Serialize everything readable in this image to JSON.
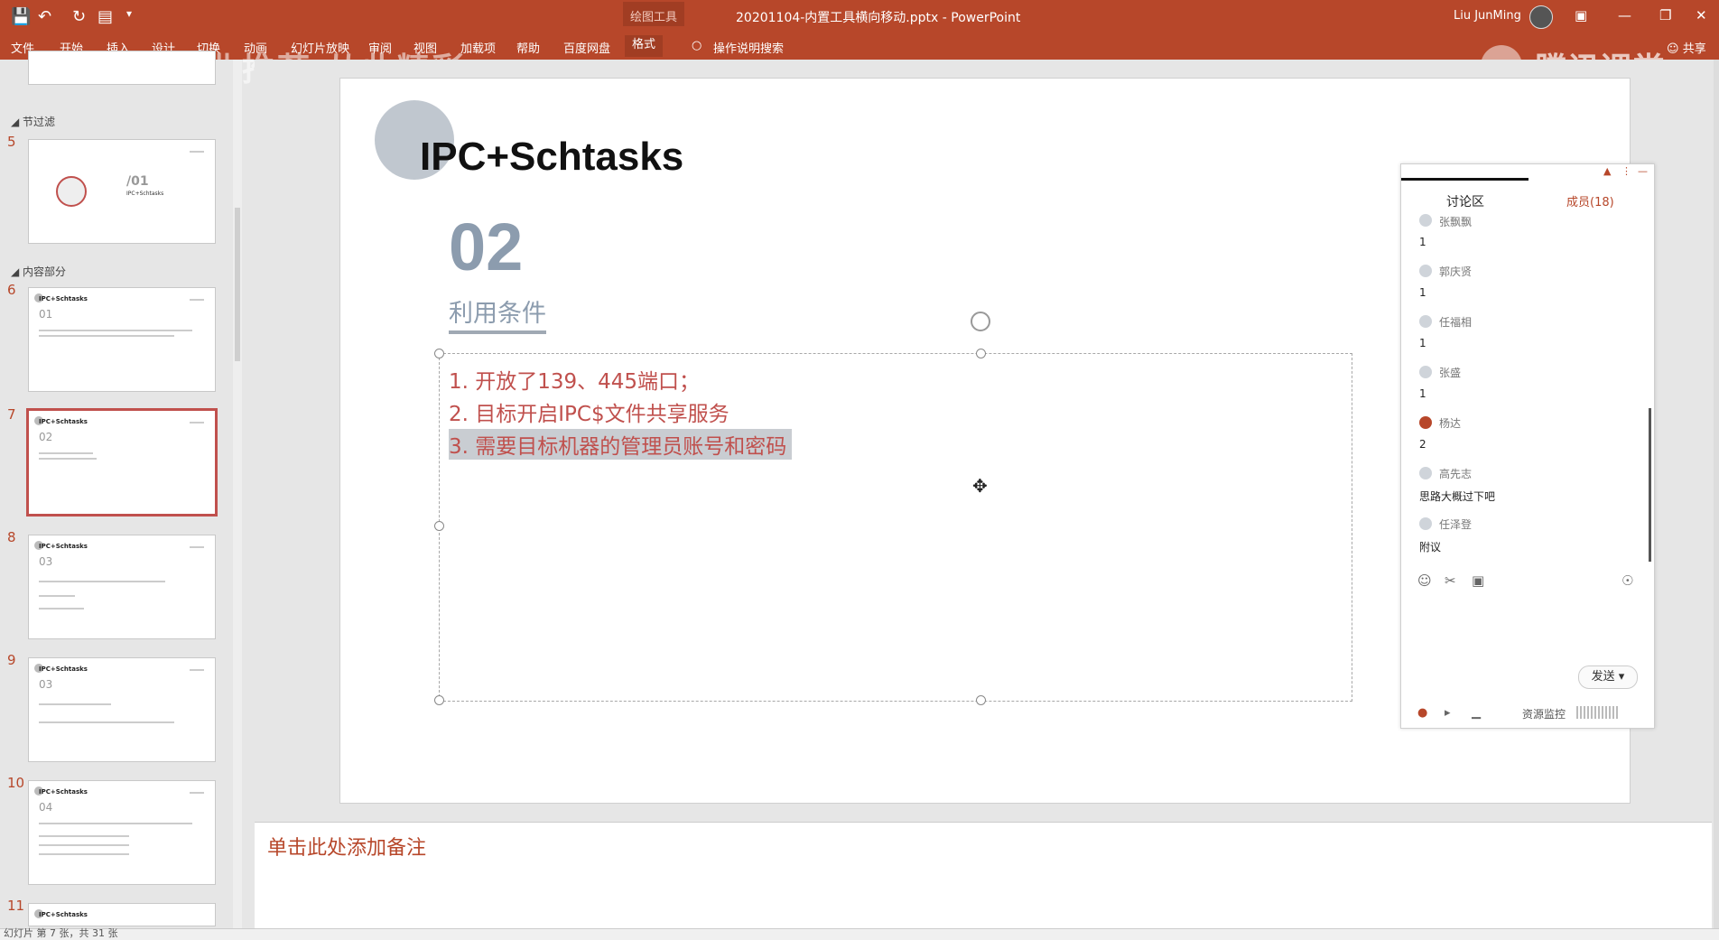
{
  "titlebar": {
    "document_title": "20201104-内置工具横向移动.pptx  -  PowerPoint",
    "context_tool_label": "绘图工具",
    "user_name": "Liu JunMing",
    "share_label": "共享",
    "menu": [
      "文件",
      "开始",
      "插入",
      "设计",
      "切换",
      "动画",
      "幻灯片放映",
      "审阅",
      "视图",
      "加载项",
      "帮助",
      "百度网盘",
      "格式"
    ],
    "tell_me": "操作说明搜索"
  },
  "watermarks": {
    "left": "网络安全就业推荐 从此精彩",
    "right": "腾讯课堂"
  },
  "slide_panel": {
    "sections": [
      "节过滤",
      "内容部分"
    ],
    "slides": [
      {
        "number": "5",
        "title": "/01",
        "subtitle": "IPC+Schtasks"
      },
      {
        "number": "6",
        "title": "IPC+Schtasks",
        "num": "01"
      },
      {
        "number": "7",
        "title": "IPC+Schtasks",
        "num": "02"
      },
      {
        "number": "8",
        "title": "IPC+Schtasks",
        "num": "03"
      },
      {
        "number": "9",
        "title": "IPC+Schtasks",
        "num": "03"
      },
      {
        "number": "10",
        "title": "IPC+Schtasks",
        "num": "04"
      },
      {
        "number": "11",
        "title": "IPC+Schtasks",
        "num": ""
      }
    ]
  },
  "slide": {
    "title": "IPC+Schtasks",
    "section_number": "02",
    "subheading": "利用条件",
    "bullets": [
      "1. 开放了139、445端口；",
      "2. 目标开启IPC$文件共享服务",
      "3. 需要目标机器的管理员账号和密码"
    ]
  },
  "notes": {
    "placeholder": "单击此处添加备注"
  },
  "statusbar": {
    "text": "幻灯片 第 7 张，共 31 张"
  },
  "chat": {
    "tab_discussion": "讨论区",
    "tab_members": "成员(18)",
    "messages": [
      {
        "name": "张飘飘",
        "text": "1"
      },
      {
        "name": "郭庆贤",
        "text": "1"
      },
      {
        "name": "任福相",
        "text": "1"
      },
      {
        "name": "张盛",
        "text": "1"
      },
      {
        "name": "杨达",
        "text": "2"
      },
      {
        "name": "高先志",
        "text": "思路大概过下吧"
      },
      {
        "name": "任泽登",
        "text": "附议"
      }
    ],
    "send_label": "发送",
    "resource_monitor": "资源监控"
  },
  "colors": {
    "accent": "#b7472a",
    "slide_red": "#c0504d",
    "slide_gray": "#8c9cae"
  }
}
